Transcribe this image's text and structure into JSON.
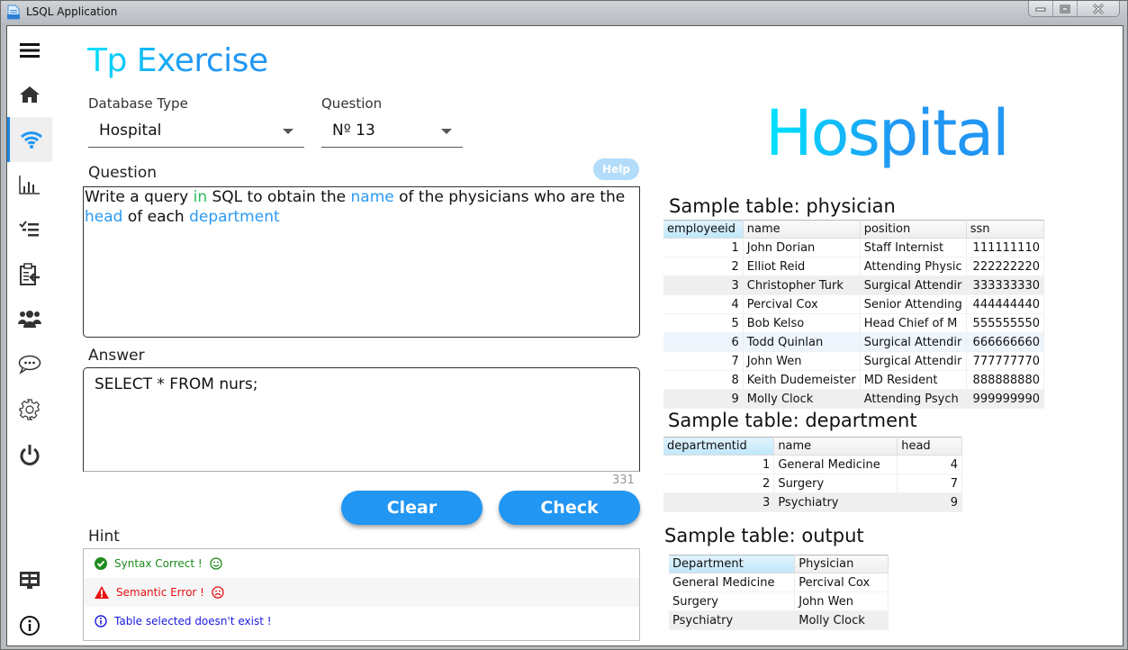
{
  "window": {
    "title": "LSQL Application",
    "controls": [
      "minimize",
      "maximize",
      "close"
    ]
  },
  "sidebar": {
    "items": [
      {
        "icon": "menu-icon"
      },
      {
        "icon": "home-icon"
      },
      {
        "icon": "wifi-icon",
        "active": true
      },
      {
        "icon": "bar-chart-icon"
      },
      {
        "icon": "checklist-icon"
      },
      {
        "icon": "clipboard-import-icon"
      },
      {
        "icon": "users-icon"
      },
      {
        "icon": "chat-icon"
      },
      {
        "icon": "gear-icon"
      },
      {
        "icon": "power-icon"
      },
      {
        "icon": "dashboard-icon"
      },
      {
        "icon": "info-icon"
      }
    ]
  },
  "main": {
    "title": "Tp Exercise",
    "database_type": {
      "label": "Database Type",
      "value": "Hospital"
    },
    "question_select": {
      "label": "Question",
      "value": "Nº 13"
    },
    "question_label": "Question",
    "help_label": "Help",
    "question_text": {
      "parts": [
        {
          "text": "Write a query ",
          "style": "normal"
        },
        {
          "text": "in",
          "style": "green"
        },
        {
          "text": " SQL to obtain the ",
          "style": "normal"
        },
        {
          "text": "name",
          "style": "blue"
        },
        {
          "text": " of the physicians who are the ",
          "style": "normal"
        },
        {
          "text": "head",
          "style": "blue"
        },
        {
          "text": " of each ",
          "style": "normal"
        },
        {
          "text": "department",
          "style": "blue"
        }
      ]
    },
    "answer_label": "Answer",
    "answer_value": "SELECT * FROM nurs;",
    "char_counter": "331",
    "clear_label": "Clear",
    "check_label": "Check",
    "hint_label": "Hint",
    "hints": [
      {
        "icon": "check-circle-icon",
        "text": "Syntax Correct !",
        "face": "smile-icon",
        "color": "#1a8a1a"
      },
      {
        "icon": "warning-icon",
        "text": "Semantic Error !",
        "face": "sad-icon",
        "color": "#e81010"
      },
      {
        "icon": "info-circle-icon",
        "text": "Table selected doesn't exist !",
        "color": "#1a1ae0"
      }
    ]
  },
  "right": {
    "db_title": "Hospital",
    "physician": {
      "title": "Sample table: physician",
      "columns": [
        "employeeid",
        "name",
        "position",
        "ssn"
      ],
      "rows": [
        [
          "1",
          "John Dorian",
          "Staff Internist",
          "111111110"
        ],
        [
          "2",
          "Elliot Reid",
          "Attending Physic",
          "222222220"
        ],
        [
          "3",
          "Christopher Turk",
          "Surgical Attendir",
          "333333330"
        ],
        [
          "4",
          "Percival Cox",
          "Senior Attending",
          "444444440"
        ],
        [
          "5",
          "Bob Kelso",
          "Head Chief of M",
          "555555550"
        ],
        [
          "6",
          "Todd Quinlan",
          "Surgical Attendir",
          "666666660"
        ],
        [
          "7",
          "John Wen",
          "Surgical Attendir",
          "777777770"
        ],
        [
          "8",
          "Keith Dudemeister",
          "MD Resident",
          "888888880"
        ],
        [
          "9",
          "Molly Clock",
          "Attending Psych",
          "999999990"
        ]
      ]
    },
    "department": {
      "title": "Sample table: department",
      "columns": [
        "departmentid",
        "name",
        "head"
      ],
      "rows": [
        [
          "1",
          "General Medicine",
          "4"
        ],
        [
          "2",
          "Surgery",
          "7"
        ],
        [
          "3",
          "Psychiatry",
          "9"
        ]
      ]
    },
    "output": {
      "title": "Sample table: output",
      "columns": [
        "Department",
        "Physician"
      ],
      "rows": [
        [
          "General Medicine",
          "Percival Cox"
        ],
        [
          "Surgery",
          "John Wen"
        ],
        [
          "Psychiatry",
          "Molly Clock"
        ]
      ]
    }
  }
}
